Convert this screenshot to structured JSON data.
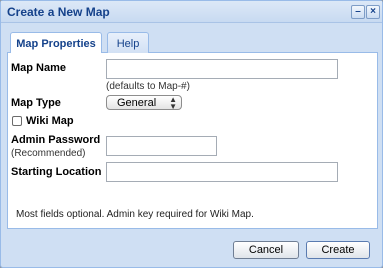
{
  "window": {
    "title": "Create a New Map",
    "minimize_glyph": "–",
    "close_glyph": "×"
  },
  "tabs": [
    {
      "label": "Map Properties",
      "active": true
    },
    {
      "label": "Help",
      "active": false
    }
  ],
  "form": {
    "map_name": {
      "label": "Map Name",
      "value": "",
      "hint": "(defaults to Map-#)"
    },
    "map_type": {
      "label": "Map Type",
      "selected": "General"
    },
    "wiki_map": {
      "label": "Wiki Map",
      "checked": false
    },
    "admin_password": {
      "label": "Admin Password",
      "sublabel": "(Recommended)",
      "value": ""
    },
    "starting_location": {
      "label": "Starting Location",
      "value": ""
    },
    "note": "Most fields optional. Admin key required for Wiki Map."
  },
  "buttons": {
    "cancel": "Cancel",
    "create": "Create"
  },
  "colors": {
    "title_text": "#15428b",
    "border": "#99bbe8",
    "frame": "#cfdff3"
  }
}
